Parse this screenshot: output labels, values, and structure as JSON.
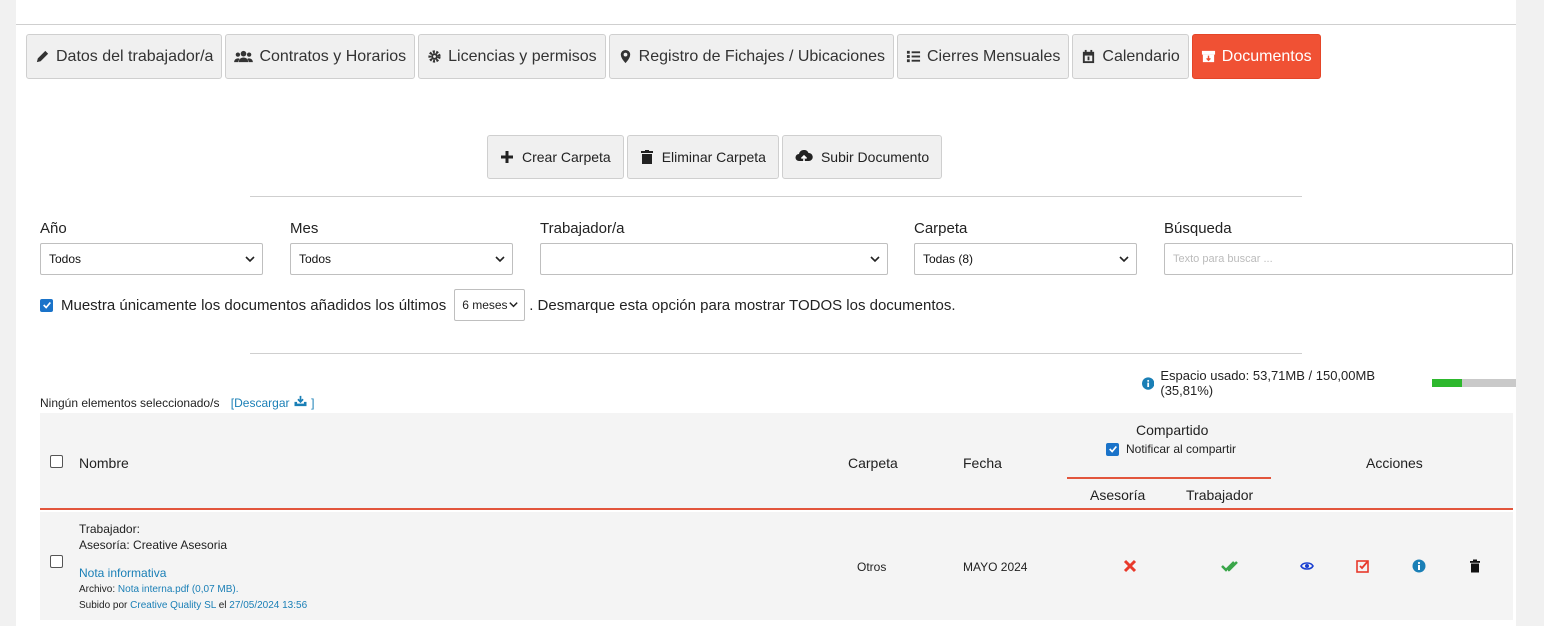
{
  "tabs": [
    {
      "label": "Datos del trabajador/a",
      "icon": "pencil-icon",
      "active": false
    },
    {
      "label": "Contratos y Horarios",
      "icon": "users-icon",
      "active": false
    },
    {
      "label": "Licencias y permisos",
      "icon": "gear-icon",
      "active": false
    },
    {
      "label": "Registro de Fichajes / Ubicaciones",
      "icon": "map-pin-icon",
      "active": false
    },
    {
      "label": "Cierres Mensuales",
      "icon": "list-icon",
      "active": false
    },
    {
      "label": "Calendario",
      "icon": "calendar-icon",
      "active": false
    },
    {
      "label": "Documentos",
      "icon": "archive-icon",
      "active": true
    }
  ],
  "actions": {
    "create": "Crear Carpeta",
    "delete": "Eliminar Carpeta",
    "upload": "Subir Documento"
  },
  "filters": {
    "year": {
      "label": "Año",
      "value": "Todos"
    },
    "month": {
      "label": "Mes",
      "value": "Todos"
    },
    "worker": {
      "label": "Trabajador/a",
      "value": ""
    },
    "folder": {
      "label": "Carpeta",
      "value": "Todas (8)"
    },
    "search": {
      "label": "Búsqueda",
      "placeholder": "Texto para buscar ..."
    }
  },
  "recent": {
    "checked": true,
    "before": "Muestra únicamente los documentos añadidos los últimos",
    "months": "6 meses",
    "after": ". Desmarque esta opción para mostrar TODOS los documentos."
  },
  "space": {
    "text": "Espacio usado: 53,71MB / 150,00MB (35,81%)",
    "percent": 35.81
  },
  "selection": {
    "text": "Ningún elementos seleccionado/s",
    "download": "[Descargar",
    "download_close": "]"
  },
  "table": {
    "headers": {
      "name": "Nombre",
      "folder": "Carpeta",
      "date": "Fecha",
      "shared": "Compartido",
      "notify": "Notificar al compartir",
      "advisory": "Asesoría",
      "worker": "Trabajador",
      "actions": "Acciones"
    },
    "rows": [
      {
        "worker_line": "Trabajador:",
        "advisory_line": "Asesoría: Creative Asesoria",
        "title": "Nota informativa",
        "file_prefix": "Archivo:",
        "file": "Nota interna.pdf (0,07 MB).",
        "uploaded_prefix": "Subido por",
        "uploaded_by": "Creative Quality SL",
        "uploaded_mid": "el",
        "uploaded_at": "27/05/2024 13:56",
        "folder": "Otros",
        "date": "MAYO 2024"
      }
    ]
  },
  "colors": {
    "accent": "#f05134",
    "link": "#1a7fb6",
    "bar": "#2db82d"
  }
}
